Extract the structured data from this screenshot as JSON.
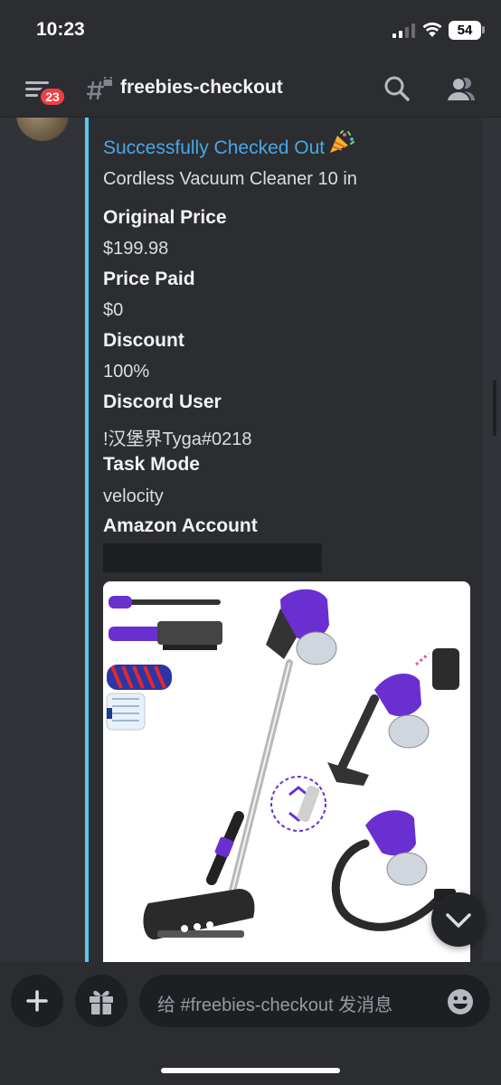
{
  "status_bar": {
    "time": "10:23",
    "battery": "54"
  },
  "header": {
    "unread_count": "23",
    "channel_name": "freebies-checkout"
  },
  "embed": {
    "title": "Successfully Checked Out",
    "description": "Cordless Vacuum Cleaner 10 in",
    "fields": [
      {
        "name": "Original Price",
        "value": "$199.98"
      },
      {
        "name": "Price Paid",
        "value": "$0"
      },
      {
        "name": "Discount",
        "value": "100%"
      },
      {
        "name": "Discord User",
        "value": "!汉堡界Tyga#0218"
      },
      {
        "name": "Task Mode",
        "value": "velocity"
      },
      {
        "name": "Amazon Account",
        "value": ""
      }
    ],
    "accent_color": "#5ac8ee"
  },
  "composer": {
    "placeholder": "给 #freebies-checkout 发消息"
  },
  "colors": {
    "background": "#313338",
    "header": "#2b2d31",
    "link": "#4aa7e6",
    "badge": "#f23f43",
    "product_purple": "#6a2fd0"
  },
  "icons": [
    "menu-icon",
    "channel-thread-icon",
    "search-icon",
    "members-icon",
    "party-popper-icon",
    "plus-icon",
    "gift-icon",
    "emoji-icon",
    "chevron-down-icon"
  ]
}
